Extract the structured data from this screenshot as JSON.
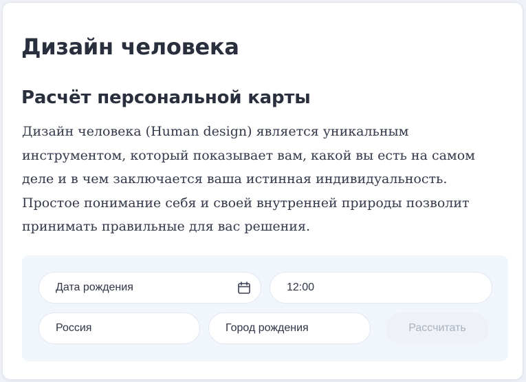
{
  "page": {
    "title": "Дизайн человека",
    "subtitle": "Расчёт персональной карты",
    "description": "Дизайн человека (Human design) является уникальным инструментом, который показывает вам, какой вы есть на самом деле и в чем заключается ваша истинная индивидуальность. Простое понимание себя и своей внутренней природы позволит принимать правильные для вас решения."
  },
  "form": {
    "birth_date": {
      "placeholder": "Дата рождения",
      "value": "",
      "icon": "calendar-icon"
    },
    "birth_time": {
      "value": "12:00"
    },
    "country": {
      "value": "Россия"
    },
    "birth_city": {
      "placeholder": "Город рождения",
      "value": ""
    },
    "submit_label": "Рассчитать",
    "submit_disabled": true
  },
  "colors": {
    "heading": "#2a2f3d",
    "body_text": "#33384a",
    "panel_bg": "#f1f5fc",
    "field_border": "#e3e8f2",
    "button_bg_disabled": "#eef1f6",
    "button_text_disabled": "#aab1bf"
  }
}
